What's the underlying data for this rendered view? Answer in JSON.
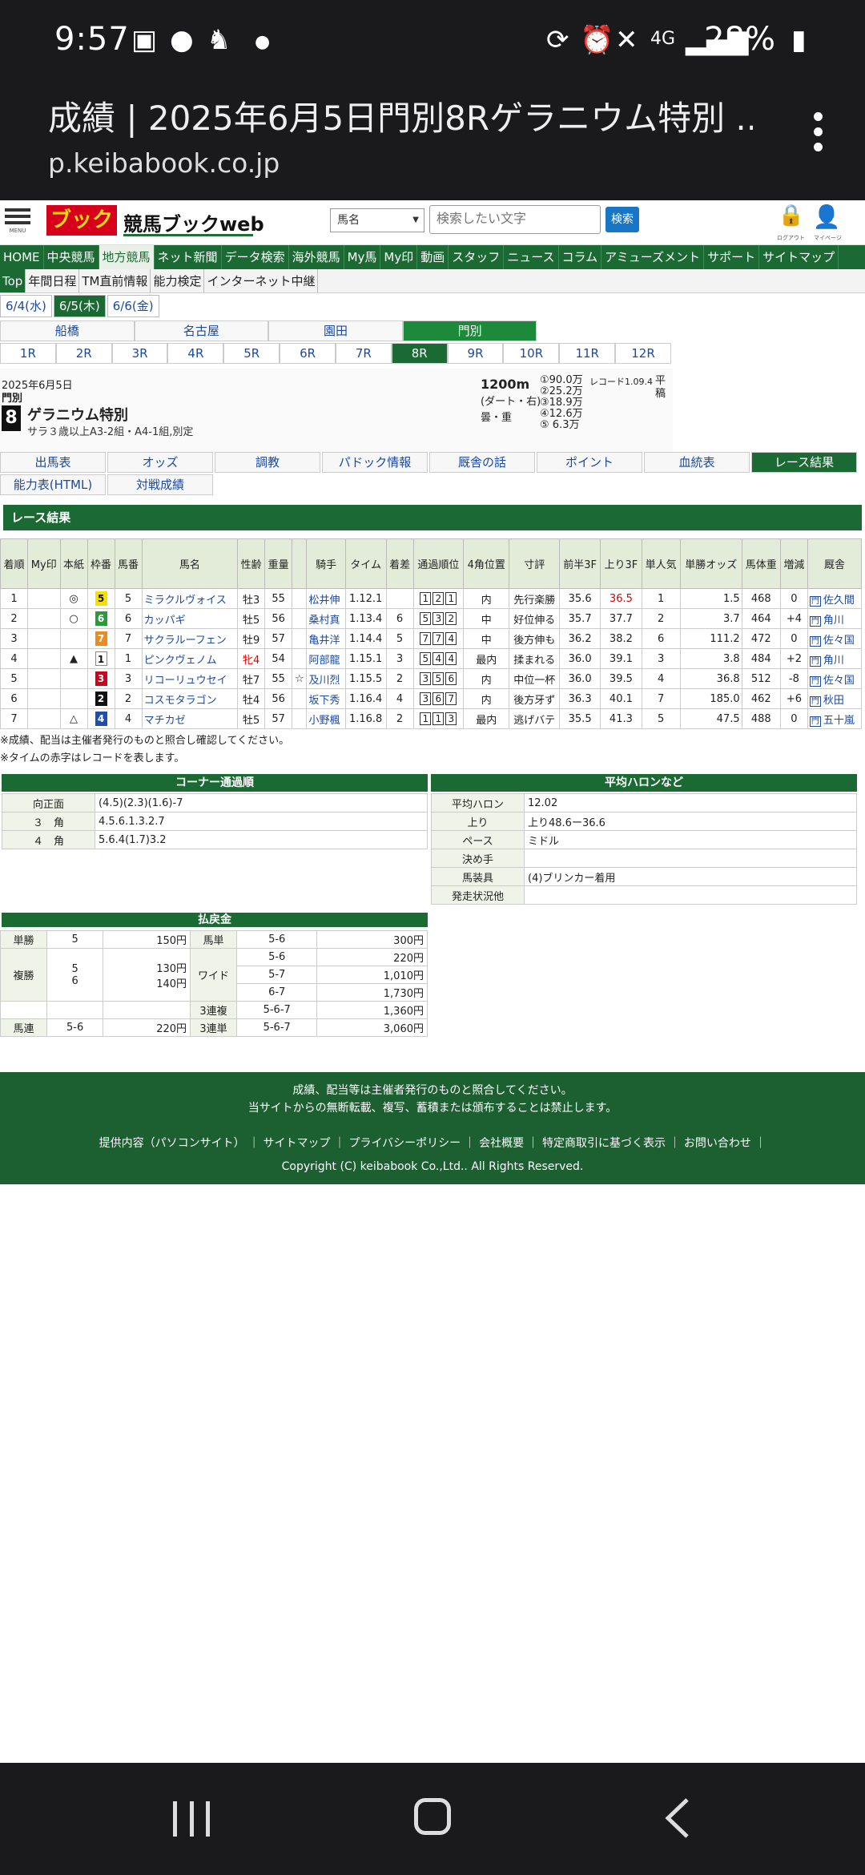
{
  "status_bar": {
    "time": "9:57",
    "battery": "28%",
    "icons": [
      "image-icon",
      "line-icon",
      "cat-icon",
      "dot-icon",
      "sync-icon",
      "alarm-icon",
      "mute-icon",
      "4g-icon",
      "signal-icon",
      "battery-icon"
    ]
  },
  "browser": {
    "title": "成績 | 2025年6月5日門別8Rゲラニウム特別 ...",
    "url": "p.keibabook.co.jp"
  },
  "header": {
    "menu_caption": "MENU",
    "logo_mark": "ブック",
    "logo_text": "競馬ブックweb",
    "search_select": "馬名",
    "search_placeholder": "検索したい文字",
    "search_button": "検索",
    "logout_caption": "ログアウト",
    "mypage_caption": "マイページ"
  },
  "main_nav": [
    "HOME",
    "中央競馬",
    "地方競馬",
    "ネット新聞",
    "データ検索",
    "海外競馬",
    "My馬",
    "My印",
    "動画",
    "スタッフ",
    "ニュース",
    "コラム",
    "アミューズメント",
    "サポート",
    "サイトマップ"
  ],
  "main_nav_active": 2,
  "sub_nav": [
    "Top",
    "年間日程",
    "TM直前情報",
    "能力検定",
    "インターネット中継"
  ],
  "sub_nav_active": 0,
  "date_tabs": [
    "6/4(水)",
    "6/5(木)",
    "6/6(金)"
  ],
  "date_active": 1,
  "tracks": [
    "船橋",
    "名古屋",
    "園田",
    "門別"
  ],
  "track_active": 3,
  "races": [
    "1R",
    "2R",
    "3R",
    "4R",
    "5R",
    "6R",
    "7R",
    "8R",
    "9R",
    "10R",
    "11R",
    "12R"
  ],
  "race_active": 7,
  "race": {
    "date": "2025年6月5日",
    "track": "門別",
    "number": "8",
    "name": "ゲラニウム特別",
    "conditions": "サラ３歳以上A3-2組・A4-1組,別定",
    "distance": "1200m",
    "course": "(ダート・右)",
    "going_weather": "曇・重",
    "prizes": [
      "①90.0万",
      "②25.2万",
      "③18.9万",
      "④12.6万",
      "⑤ 6.3万"
    ],
    "record": "レコード1.09.4",
    "weight_type": "平　稿"
  },
  "info_tabs": [
    "出馬表",
    "オッズ",
    "調教",
    "パドック情報",
    "厩舎の話",
    "ポイント",
    "血統表",
    "レース結果",
    "能力表(HTML)",
    "対戦成績"
  ],
  "info_active": 7,
  "section_title": "レース結果",
  "result_headers": [
    "着順",
    "My印",
    "本紙",
    "枠番",
    "馬番",
    "馬名",
    "性齢",
    "重量",
    "",
    "騎手",
    "タイム",
    "着差",
    "通過順位",
    "4角位置",
    "寸評",
    "前半3F",
    "上り3F",
    "単人気",
    "単勝オッズ",
    "馬体重",
    "増減",
    "厩舎"
  ],
  "results": [
    {
      "rank": "1",
      "my": "",
      "mark": "◎",
      "waku": "5",
      "num": "5",
      "name": "ミラクルヴォイス",
      "sex": "牡3",
      "weight": "55",
      "sym": "",
      "jockey": "松井伸",
      "time": "1.12.1",
      "margin": "",
      "pass": [
        "1",
        "2",
        "1"
      ],
      "pos4": "内",
      "comment": "先行楽勝",
      "f3a": "35.6",
      "f3b": "36.5",
      "pop": "1",
      "odds": "1.5",
      "bw": "468",
      "diff": "0",
      "trainer": "佐久間"
    },
    {
      "rank": "2",
      "my": "",
      "mark": "○",
      "waku": "6",
      "num": "6",
      "name": "カッパギ",
      "sex": "牡5",
      "weight": "56",
      "sym": "",
      "jockey": "桑村真",
      "time": "1.13.4",
      "margin": "6",
      "pass": [
        "5",
        "3",
        "2"
      ],
      "pos4": "中",
      "comment": "好位伸る",
      "f3a": "35.7",
      "f3b": "37.7",
      "pop": "2",
      "odds": "3.7",
      "bw": "464",
      "diff": "+4",
      "trainer": "角川"
    },
    {
      "rank": "3",
      "my": "",
      "mark": "",
      "waku": "7",
      "num": "7",
      "name": "サクラルーフェン",
      "sex": "牡9",
      "weight": "57",
      "sym": "",
      "jockey": "亀井洋",
      "time": "1.14.4",
      "margin": "5",
      "pass": [
        "7",
        "7",
        "4"
      ],
      "pos4": "中",
      "comment": "後方伸も",
      "f3a": "36.2",
      "f3b": "38.2",
      "pop": "6",
      "odds": "111.2",
      "bw": "472",
      "diff": "0",
      "trainer": "佐々国"
    },
    {
      "rank": "4",
      "my": "",
      "mark": "▲",
      "waku": "1",
      "num": "1",
      "name": "ピンクヴェノム",
      "sex": "牝4",
      "weight": "54",
      "sym": "",
      "jockey": "阿部龍",
      "time": "1.15.1",
      "margin": "3",
      "pass": [
        "5",
        "4",
        "4"
      ],
      "pos4": "最内",
      "comment": "揉まれる",
      "f3a": "36.0",
      "f3b": "39.1",
      "pop": "3",
      "odds": "3.8",
      "bw": "484",
      "diff": "+2",
      "trainer": "角川"
    },
    {
      "rank": "5",
      "my": "",
      "mark": "",
      "waku": "3",
      "num": "3",
      "name": "リコーリュウセイ",
      "sex": "牡7",
      "weight": "55",
      "sym": "☆",
      "jockey": "及川烈",
      "time": "1.15.5",
      "margin": "2",
      "pass": [
        "3",
        "5",
        "6"
      ],
      "pos4": "内",
      "comment": "中位一杯",
      "f3a": "36.0",
      "f3b": "39.5",
      "pop": "4",
      "odds": "36.8",
      "bw": "512",
      "diff": "-8",
      "trainer": "佐々国"
    },
    {
      "rank": "6",
      "my": "",
      "mark": "",
      "waku": "2",
      "num": "2",
      "name": "コスモタラゴン",
      "sex": "牡4",
      "weight": "56",
      "sym": "",
      "jockey": "坂下秀",
      "time": "1.16.4",
      "margin": "4",
      "pass": [
        "3",
        "6",
        "7"
      ],
      "pos4": "内",
      "comment": "後方牙ず",
      "f3a": "36.3",
      "f3b": "40.1",
      "pop": "7",
      "odds": "185.0",
      "bw": "462",
      "diff": "+6",
      "trainer": "秋田"
    },
    {
      "rank": "7",
      "my": "",
      "mark": "△",
      "waku": "4",
      "num": "4",
      "name": "マチカゼ",
      "sex": "牡5",
      "weight": "57",
      "sym": "",
      "jockey": "小野楓",
      "time": "1.16.8",
      "margin": "2",
      "pass": [
        "1",
        "1",
        "3"
      ],
      "pos4": "最内",
      "comment": "逃げバテ",
      "f3a": "35.5",
      "f3b": "41.3",
      "pop": "5",
      "odds": "47.5",
      "bw": "488",
      "diff": "0",
      "trainer": "五十嵐"
    }
  ],
  "waku_colors": {
    "1": "#ffffff",
    "2": "#111111",
    "3": "#d0021b",
    "4": "#1c4fb0",
    "5": "#f6e000",
    "6": "#2a9a3a",
    "7": "#f08a1a"
  },
  "trainer_prefix": "門",
  "notes": [
    "※成績、配当は主催者発行のものと照合し確認してください。",
    "※タイムの赤字はレコードを表します。"
  ],
  "corner": {
    "title": "コーナー通過順",
    "rows": [
      {
        "k": "向正面",
        "v": "(4.5)(2.3)(1.6)-7"
      },
      {
        "k": "３　角",
        "v": "4.5.6.1.3.2.7"
      },
      {
        "k": "４　角",
        "v": "5.6.4(1.7)3.2"
      }
    ]
  },
  "halon": {
    "title": "平均ハロンなど",
    "rows": [
      {
        "k": "平均ハロン",
        "v": "12.02"
      },
      {
        "k": "上り",
        "v": "上り48.6ー36.6"
      },
      {
        "k": "ペース",
        "v": "ミドル"
      },
      {
        "k": "決め手",
        "v": ""
      },
      {
        "k": "馬装具",
        "v": "(4)ブリンカー着用"
      },
      {
        "k": "発走状況他",
        "v": ""
      }
    ]
  },
  "payout": {
    "title": "払戻金",
    "tansho": {
      "k": "単勝",
      "n": "5",
      "amt": "150円"
    },
    "umatan": {
      "k": "馬単",
      "n": "5-6",
      "amt": "300円"
    },
    "fukusho": {
      "k": "複勝",
      "n": [
        "5",
        "6"
      ],
      "amt": [
        "130円",
        "140円"
      ]
    },
    "wide": {
      "k": "ワイド",
      "n": [
        "5-6",
        "5-7",
        "6-7"
      ],
      "amt": [
        "220円",
        "1,010円",
        "1,730円"
      ]
    },
    "trio": {
      "k": "3連複",
      "n": "5-6-7",
      "amt": "1,360円"
    },
    "umaren": {
      "k": "馬連",
      "n": "5-6",
      "amt": "220円"
    },
    "trifecta": {
      "k": "3連単",
      "n": "5-6-7",
      "amt": "3,060円"
    }
  },
  "footer": {
    "line1": "成績、配当等は主催者発行のものと照合してください。",
    "line2": "当サイトからの無断転載、複写、蓄積または頒布することは禁止します。",
    "links": "提供内容（パソコンサイト） ｜ サイトマップ ｜ プライバシーポリシー ｜ 会社概要 ｜ 特定商取引に基づく表示 ｜ お問い合わせ ｜",
    "copyright": "Copyright (C) keibabook Co.,Ltd.. All Rights Reserved."
  }
}
